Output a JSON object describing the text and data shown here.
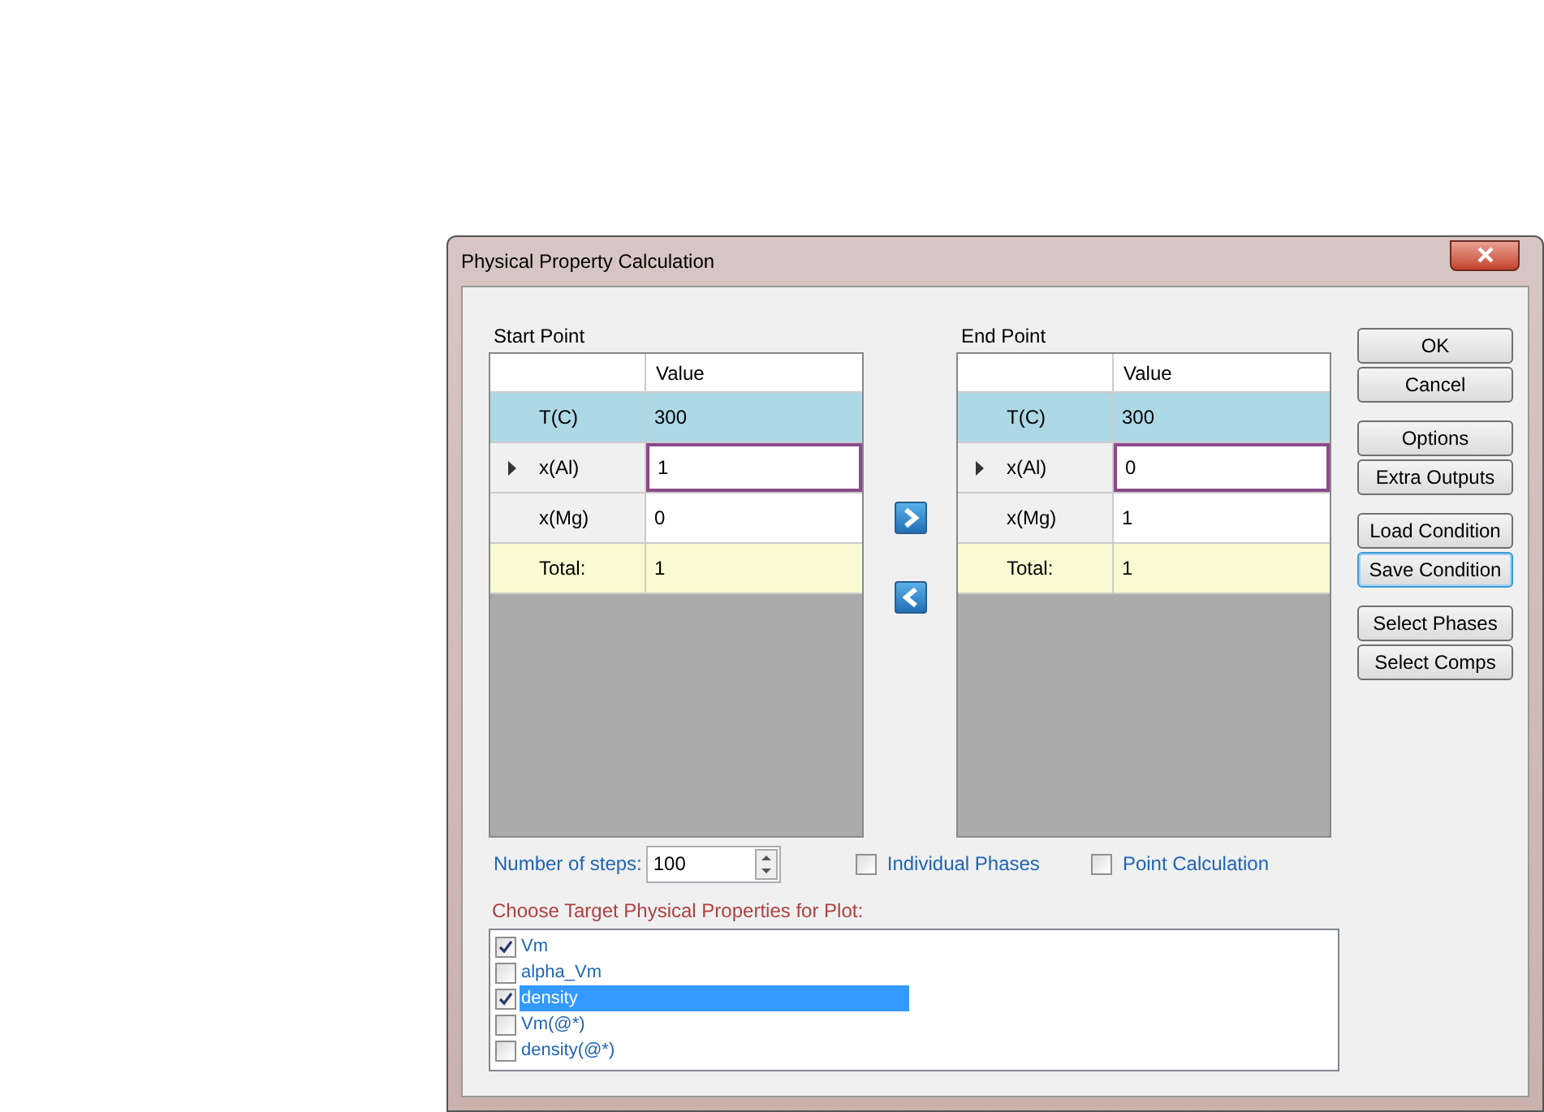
{
  "window": {
    "title": "Physical Property Calculation"
  },
  "grids": [
    {
      "label": "Start Point",
      "column_header": "Value",
      "rows": [
        {
          "label": "T(C)",
          "value": "300",
          "kind": "fixed",
          "current": false
        },
        {
          "label": "x(Al)",
          "value": "1",
          "kind": "input",
          "current": true
        },
        {
          "label": "x(Mg)",
          "value": "0",
          "kind": "input",
          "current": false
        },
        {
          "label": "Total:",
          "value": "1",
          "kind": "total",
          "current": false
        }
      ]
    },
    {
      "label": "End Point",
      "column_header": "Value",
      "rows": [
        {
          "label": "T(C)",
          "value": "300",
          "kind": "fixed",
          "current": false
        },
        {
          "label": "x(Al)",
          "value": "0",
          "kind": "input",
          "current": true
        },
        {
          "label": "x(Mg)",
          "value": "1",
          "kind": "input",
          "current": false
        },
        {
          "label": "Total:",
          "value": "1",
          "kind": "total",
          "current": false
        }
      ]
    }
  ],
  "button_groups": [
    [
      {
        "label": "OK",
        "focused": false
      },
      {
        "label": "Cancel",
        "focused": false
      }
    ],
    [
      {
        "label": "Options",
        "focused": false
      },
      {
        "label": "Extra Outputs",
        "focused": false
      }
    ],
    [
      {
        "label": "Load Condition",
        "focused": false
      },
      {
        "label": "Save Condition",
        "focused": true
      }
    ],
    [
      {
        "label": "Select Phases",
        "focused": false
      },
      {
        "label": "Select Comps",
        "focused": false
      }
    ]
  ],
  "steps": {
    "label": "Number of steps:",
    "value": "100"
  },
  "options": [
    {
      "label": "Individual Phases",
      "checked": false
    },
    {
      "label": "Point Calculation",
      "checked": false
    }
  ],
  "properties": {
    "label": "Choose Target Physical Properties for Plot:",
    "items": [
      {
        "label": "Vm",
        "checked": true,
        "selected": false
      },
      {
        "label": "alpha_Vm",
        "checked": false,
        "selected": false
      },
      {
        "label": "density",
        "checked": true,
        "selected": true
      },
      {
        "label": "Vm(@*)",
        "checked": false,
        "selected": false
      },
      {
        "label": "density(@*)",
        "checked": false,
        "selected": false
      }
    ]
  }
}
